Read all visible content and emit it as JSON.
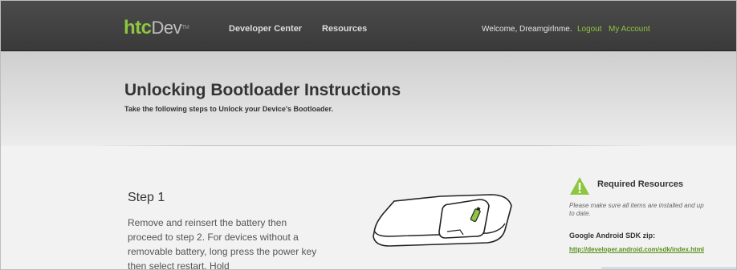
{
  "header": {
    "logo_htc": "htc",
    "logo_dev": "Dev",
    "logo_tm": "TM",
    "nav": [
      "Developer Center",
      "Resources"
    ],
    "welcome": "Welcome, Dreamgirlnme.",
    "logout": "Logout",
    "my_account": "My Account",
    "accent_color": "#8dc63f"
  },
  "hero": {
    "title": "Unlocking Bootloader Instructions",
    "subtitle": "Take the following steps to Unlock your Device's Bootloader."
  },
  "step": {
    "title": "Step 1",
    "body": "Remove and reinsert the battery then proceed to step 2. For devices without a removable battery, long press the power key then select restart. Hold"
  },
  "sidebar": {
    "icon": "warning-icon",
    "title": "Required Resources",
    "note": "Please make sure all items are installed and up to date.",
    "sdk_title": "Google Android SDK zip:",
    "sdk_link": "http://developer.android.com/sdk/index.html"
  }
}
